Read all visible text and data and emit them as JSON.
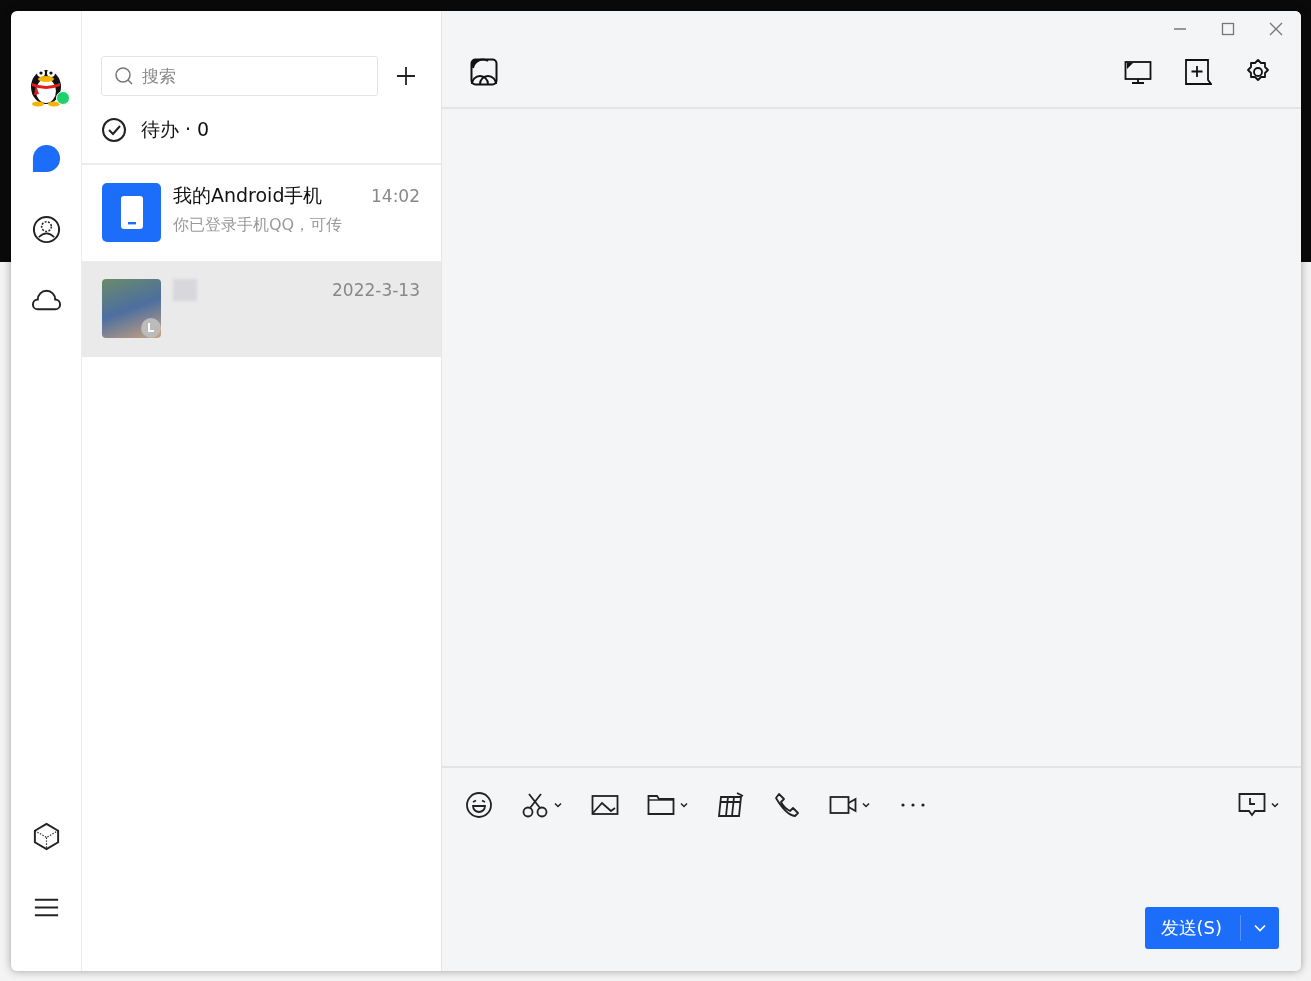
{
  "sidebar": {
    "online": true,
    "nav": [
      {
        "kind": "chat",
        "selected": true
      },
      {
        "kind": "contacts",
        "selected": false
      },
      {
        "kind": "cloud",
        "selected": false
      }
    ],
    "bottom": [
      {
        "kind": "cube"
      },
      {
        "kind": "menu"
      }
    ]
  },
  "conversation_list": {
    "search": {
      "placeholder": "搜索"
    },
    "todo": "待办 · 0",
    "items": [
      {
        "kind": "device",
        "name": "我的Android手机",
        "time": "14:02",
        "preview": "你已登录手机QQ，可传",
        "selected": false
      },
      {
        "kind": "photo",
        "time": "2022-3-13",
        "selected": true
      }
    ]
  },
  "chat": {
    "toolbar": [
      {
        "kind": "emoji",
        "dropdown": false
      },
      {
        "kind": "scissors",
        "dropdown": true
      },
      {
        "kind": "image",
        "dropdown": false
      },
      {
        "kind": "folder",
        "dropdown": true
      },
      {
        "kind": "gift",
        "dropdown": false
      },
      {
        "kind": "phone",
        "dropdown": false
      },
      {
        "kind": "video",
        "dropdown": true
      },
      {
        "kind": "more",
        "dropdown": false
      }
    ],
    "send_button": "发送(S)"
  }
}
